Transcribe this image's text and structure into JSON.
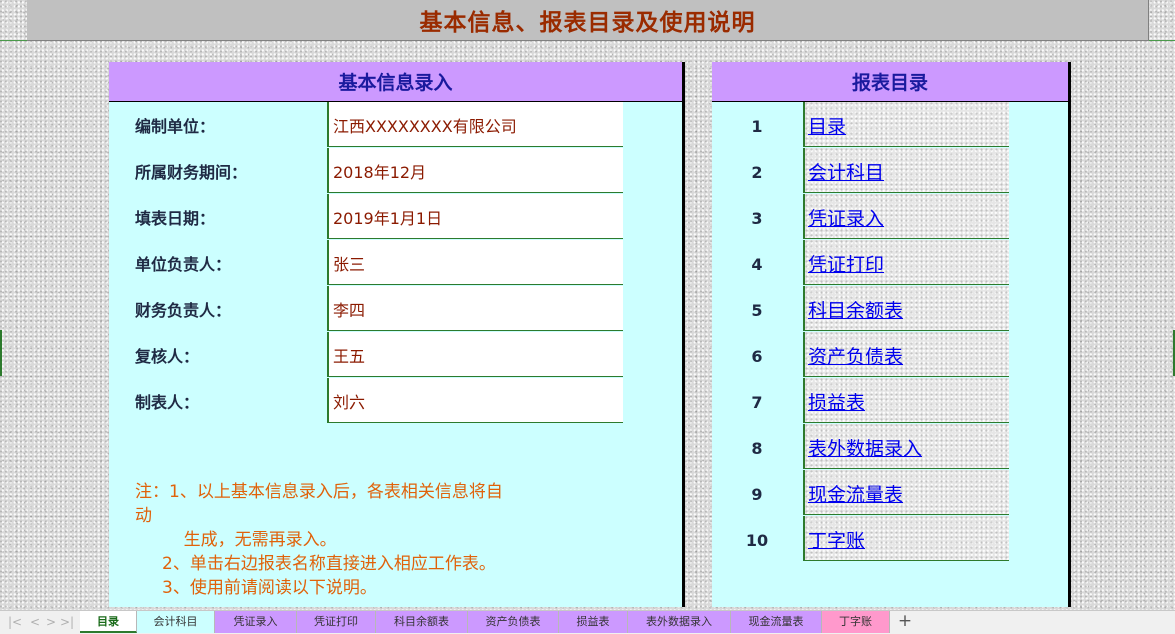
{
  "title": "基本信息、报表目录及使用说明",
  "info": {
    "header": "基本信息录入",
    "rows": [
      {
        "label": "编制单位：",
        "value": "江西XXXXXXXX有限公司"
      },
      {
        "label": "所属财务期间：",
        "value": "2018年12月"
      },
      {
        "label": "填表日期：",
        "value": "2019年1月1日"
      },
      {
        "label": "单位负责人：",
        "value": "张三"
      },
      {
        "label": "财务负责人：",
        "value": "李四"
      },
      {
        "label": "复核人：",
        "value": "王五"
      },
      {
        "label": "制表人：",
        "value": "刘六"
      }
    ],
    "notes": [
      "注：1、以上基本信息录入后，各表相关信息将自",
      "动",
      "         生成，无需再录入。",
      "     2、单击右边报表名称直接进入相应工作表。",
      "     3、使用前请阅读以下说明。"
    ]
  },
  "toc": {
    "header": "报表目录",
    "items": [
      {
        "num": "1",
        "label": "目录"
      },
      {
        "num": "2",
        "label": "会计科目"
      },
      {
        "num": "3",
        "label": "凭证录入"
      },
      {
        "num": "4",
        "label": "凭证打印"
      },
      {
        "num": "5",
        "label": "科目余额表"
      },
      {
        "num": "6",
        "label": "资产负债表"
      },
      {
        "num": "7",
        "label": "损益表"
      },
      {
        "num": "8",
        "label": "表外数据录入"
      },
      {
        "num": "9",
        "label": "现金流量表"
      },
      {
        "num": "10",
        "label": "丁字账"
      }
    ]
  },
  "tabs": {
    "nav_first": "|<",
    "nav_prev": "<",
    "nav_next": ">",
    "nav_last": ">|",
    "add_label": "+",
    "items": [
      {
        "label": "目录",
        "color": "#ffffff",
        "active": true
      },
      {
        "label": "会计科目",
        "color": "#ccffff",
        "active": false
      },
      {
        "label": "凭证录入",
        "color": "#cc99ff",
        "active": false
      },
      {
        "label": "凭证打印",
        "color": "#cc99ff",
        "active": false
      },
      {
        "label": "科目余额表",
        "color": "#cc99ff",
        "active": false
      },
      {
        "label": "资产负债表",
        "color": "#cc99ff",
        "active": false
      },
      {
        "label": "损益表",
        "color": "#cc99ff",
        "active": false
      },
      {
        "label": "表外数据录入",
        "color": "#cc99ff",
        "active": false
      },
      {
        "label": "现金流量表",
        "color": "#cc99ff",
        "active": false
      },
      {
        "label": "丁字账",
        "color": "#ff99cc",
        "active": false
      }
    ]
  }
}
